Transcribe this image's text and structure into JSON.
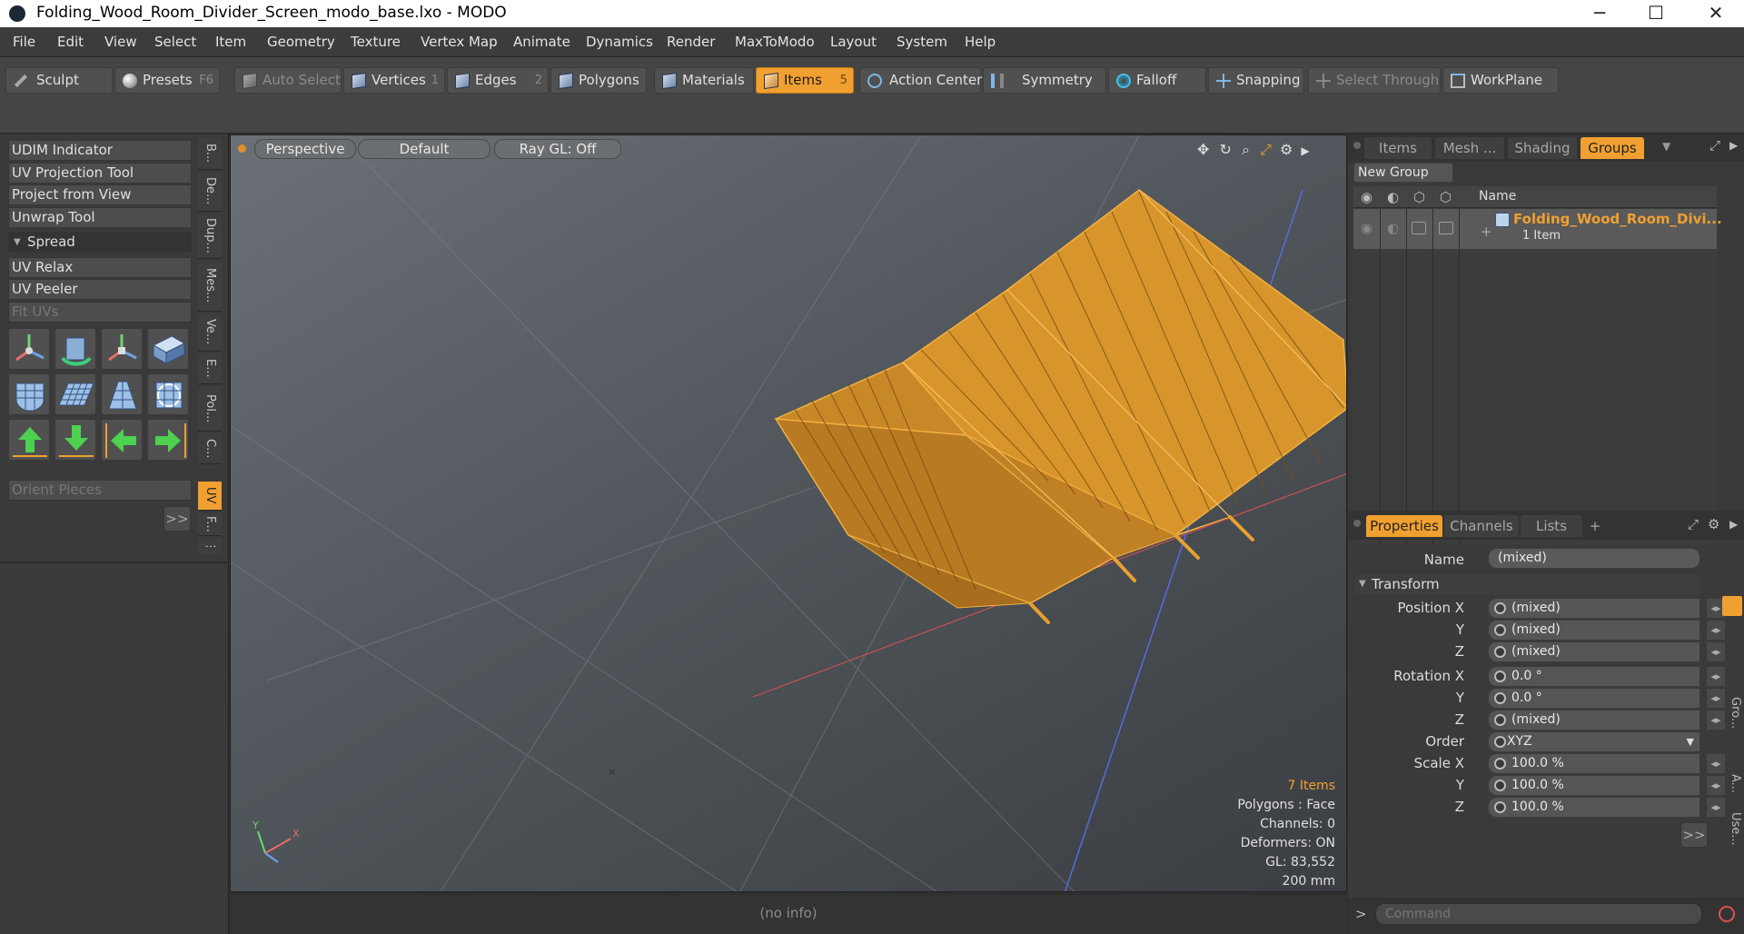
{
  "window": {
    "title": "Folding_Wood_Room_Divider_Screen_modo_base.lxo - MODO",
    "minimize": "─",
    "maximize": "☐",
    "close": "✕"
  },
  "menu": [
    "File",
    "Edit",
    "View",
    "Select",
    "Item",
    "Geometry",
    "Texture",
    "Vertex Map",
    "Animate",
    "Dynamics",
    "Render",
    "MaxToModo",
    "Layout",
    "System",
    "Help"
  ],
  "toolbar": {
    "sculpt": "Sculpt",
    "presets": "Presets",
    "presets_key": "F6",
    "auto_select": "Auto Select",
    "vertices": "Vertices",
    "vertices_key": "1",
    "edges": "Edges",
    "edges_key": "2",
    "polygons": "Polygons",
    "materials": "Materials",
    "items": "Items",
    "items_key": "5",
    "action_center": "Action Center",
    "symmetry": "Symmetry",
    "falloff": "Falloff",
    "snapping": "Snapping",
    "select_through": "Select Through",
    "workplane": "WorkPlane"
  },
  "left_panel": {
    "udim": "UDIM Indicator",
    "uv_projection": "UV Projection Tool",
    "project_from_view": "Project from View",
    "unwrap": "Unwrap Tool",
    "spread": "Spread",
    "uv_relax": "UV Relax",
    "uv_peeler": "UV Peeler",
    "fit_uvs": "Fit UVs",
    "orient_pieces": "Orient Pieces",
    "more": ">>"
  },
  "vertical_tabs": [
    "B...",
    "De...",
    "Dup...",
    "Mes...",
    "Ve...",
    "E...",
    "Pol...",
    "C...",
    "UV",
    "F...",
    "⋮"
  ],
  "viewport": {
    "view": "Perspective",
    "shading": "Default",
    "raygl": "Ray GL: Off",
    "info": {
      "items": "7 Items",
      "polygons": "Polygons : Face",
      "channels": "Channels: 0",
      "deformers": "Deformers: ON",
      "gl": "GL: 83,552",
      "size": "200 mm"
    },
    "axis_y": "Y",
    "axis_x": "X"
  },
  "status": "(no info)",
  "right_top": {
    "tabs": [
      "Items",
      "Mesh ...",
      "Shading",
      "Groups"
    ],
    "new_group": "New Group",
    "col_name": "Name",
    "group_name": "Folding_Wood_Room_Divi...",
    "group_count": "1 Item"
  },
  "properties": {
    "tabs": [
      "Properties",
      "Channels",
      "Lists",
      "+"
    ],
    "name_label": "Name",
    "name_value": "(mixed)",
    "transform": "Transform",
    "rows": [
      {
        "label": "Position X",
        "value": "(mixed)"
      },
      {
        "label": "Y",
        "value": "(mixed)"
      },
      {
        "label": "Z",
        "value": "(mixed)"
      },
      {
        "label": "Rotation X",
        "value": "0.0 °"
      },
      {
        "label": "Y",
        "value": "0.0 °"
      },
      {
        "label": "Z",
        "value": "(mixed)"
      },
      {
        "label": "Order",
        "value": "XYZ"
      },
      {
        "label": "Scale X",
        "value": "100.0 %"
      },
      {
        "label": "Y",
        "value": "100.0 %"
      },
      {
        "label": "Z",
        "value": "100.0 %"
      }
    ],
    "more": ">>",
    "side_tabs": [
      "Gro...",
      "A...",
      "Use..."
    ]
  },
  "command": {
    "prompt": ">",
    "placeholder": "Command"
  }
}
